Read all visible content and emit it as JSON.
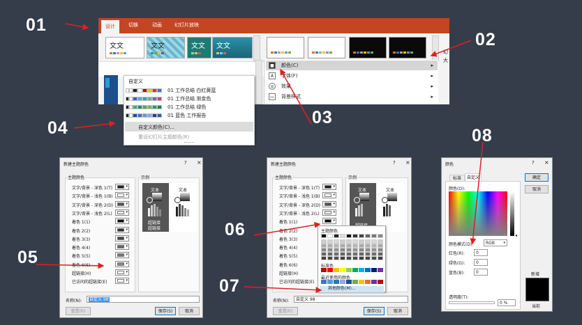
{
  "steps": [
    "01",
    "02",
    "03",
    "04",
    "05",
    "06",
    "07",
    "08"
  ],
  "ribbon": {
    "tabs": [
      "设计",
      "切换",
      "动画",
      "幻灯片放映"
    ],
    "theme_text": "文文",
    "right_edge": [
      "幻",
      "大"
    ]
  },
  "dropdown": {
    "header": "自定义",
    "rows": [
      {
        "label": "01 工作总结 白红黄蓝",
        "colors": [
          "#ffffff",
          "#ffffff",
          "#222222",
          "#ffffff",
          "#c00000",
          "#ffc000",
          "#e03030",
          "#4472c4"
        ]
      },
      {
        "label": "01 工作总结 渐变色",
        "colors": [
          "#222222",
          "#ffffff",
          "#3a5fcd",
          "#40b0e0",
          "#30a0d0",
          "#60c060",
          "#8060c0",
          "#d04080"
        ]
      },
      {
        "label": "01 工作总结 绿色",
        "colors": [
          "#222222",
          "#ffffff",
          "#3cb371",
          "#2e8b57",
          "#4caf50",
          "#66bb6a",
          "#20a060",
          "#208050"
        ]
      },
      {
        "label": "01 蓝色 工作报告",
        "colors": [
          "#222222",
          "#ffffff",
          "#1f4e99",
          "#2e75b6",
          "#5b9bd5",
          "#8faadc",
          "#1f3f7f",
          "#2060a0"
        ]
      }
    ],
    "custom": "自定义颜色(C)...",
    "reset": "重设幻灯片主题颜色(R)"
  },
  "submenu": {
    "items": [
      {
        "label": "颜色(C)",
        "icon": "■"
      },
      {
        "label": "字体(F)",
        "icon": "A"
      },
      {
        "label": "效果",
        "icon": "◎"
      },
      {
        "label": "背景样式",
        "icon": "▭"
      }
    ]
  },
  "theme_dialog": {
    "title": "新建主题颜色",
    "qm": "?",
    "x": "×",
    "group_main": "主题颜色",
    "group_sample": "示例",
    "rows": [
      "文字/背景 - 深色 1(T)",
      "文字/背景 - 浅色 1(B)",
      "文字/背景 - 深色 2(D)",
      "文字/背景 - 浅色 2(L)",
      "着色 1(1)",
      "着色 2(2)",
      "着色 3(3)",
      "着色 4(4)",
      "着色 5(5)",
      "着色 6(6)",
      "超链接(H)",
      "已访问的超链接(E)"
    ],
    "row_colors": [
      "#222222",
      "#ffffff",
      "#555555",
      "#e8e8e8",
      "#111111",
      "#333333",
      "#444444",
      "#666666",
      "#777777",
      "#888888",
      "#ffffff",
      "#ffffff"
    ],
    "sample_text": "文本",
    "sample_link": "超链接",
    "name_label": "名称(N):",
    "name_value": "自定义 98",
    "reset": "重置(R)",
    "save": "保存(S)",
    "cancel": "取消"
  },
  "palette": {
    "title": "主题颜色",
    "standard": "标准色",
    "recent": "最近使用的颜色",
    "more": "其他颜色(M)..."
  },
  "color_dialog": {
    "title": "颜色",
    "qm": "?",
    "x": "×",
    "tab_standard": "标准",
    "tab_custom": "自定义",
    "colors_label": "颜色(O):",
    "mode_label": "颜色模式(D):",
    "mode_value": "RGB",
    "red": "红色(R):",
    "green": "绿色(G):",
    "blue": "蓝色(B):",
    "value": "0",
    "transparency": "透明度(T):",
    "pct": "0 %",
    "ok": "确定",
    "cancel": "取消",
    "new": "新增",
    "current": "当前"
  },
  "colors": {
    "accent": "#c2461f",
    "arrow": "#e02020",
    "bg": "#353d4b"
  }
}
